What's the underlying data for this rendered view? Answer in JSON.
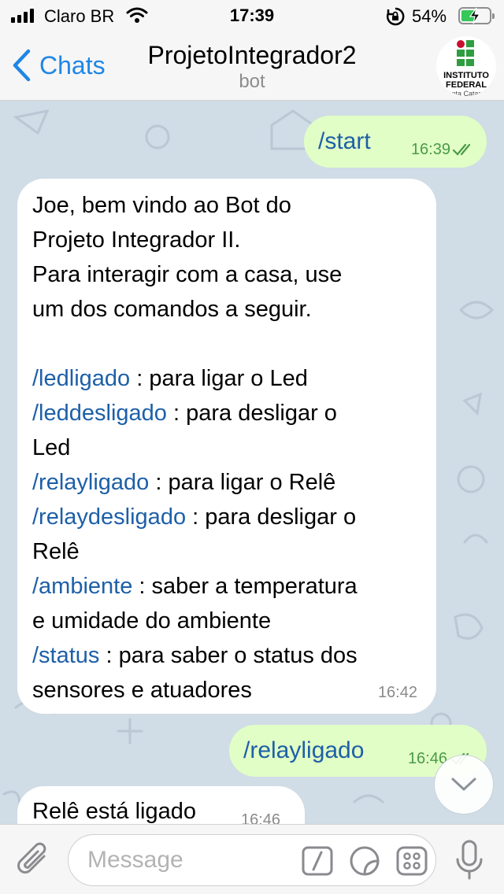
{
  "status_bar": {
    "carrier": "Claro BR",
    "time": "17:39",
    "battery": "54%",
    "battery_level": 0.54
  },
  "header": {
    "back_label": "Chats",
    "title": "ProjetoIntegrador2",
    "subtitle": "bot",
    "avatar": {
      "line1": "INSTITUTO",
      "line2": "FEDERAL",
      "line3": "nta Catar"
    }
  },
  "messages": [
    {
      "direction": "outgoing",
      "text": "/start",
      "time": "16:39",
      "status": "read"
    },
    {
      "direction": "incoming",
      "greeting": [
        "Joe, bem vindo ao Bot do",
        "Projeto Integrador II.",
        "Para interagir com a casa, use",
        "um dos comandos a seguir."
      ],
      "commands": [
        {
          "cmd": "/ledligado",
          "desc": " : para ligar o Led"
        },
        {
          "cmd": "/leddesligado",
          "desc": " : para desligar o",
          "desc2": "Led"
        },
        {
          "cmd": "/relayligado",
          "desc": " : para ligar o Relê"
        },
        {
          "cmd": "/relaydesligado",
          "desc": " : para desligar o",
          "desc2": "Relê"
        },
        {
          "cmd": "/ambiente",
          "desc": " : saber a temperatura",
          "desc2": "e umidade do ambiente"
        },
        {
          "cmd": "/status",
          "desc": " : para saber o status dos",
          "desc2": "sensores e atuadores"
        }
      ],
      "time": "16:42"
    },
    {
      "direction": "outgoing",
      "text": "/relayligado",
      "time": "16:46",
      "status": "read"
    },
    {
      "direction": "incoming",
      "text": "Relê está ligado",
      "time": "16:46"
    }
  ],
  "input": {
    "placeholder": "Message"
  },
  "colors": {
    "outgoing_bubble": "#e1fec6",
    "incoming_bubble": "#ffffff",
    "link": "#1d5fa8",
    "accent": "#1f86e5",
    "chat_bg": "#d0dce6"
  }
}
